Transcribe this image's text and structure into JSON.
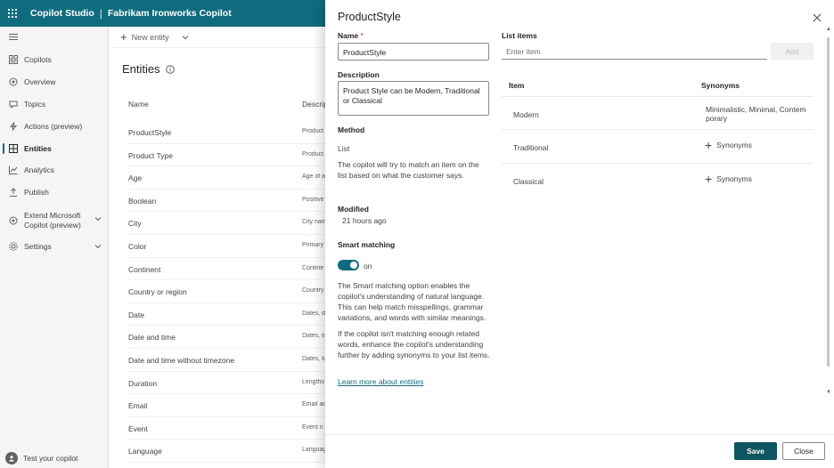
{
  "topbar": {
    "app_title": "Copilot Studio",
    "separator": "|",
    "bot_title": "Fabrikam Ironworks Copilot"
  },
  "sidebar": {
    "items": [
      {
        "label": "Copilots",
        "icon": "copilots-icon"
      },
      {
        "label": "Overview",
        "icon": "overview-icon"
      },
      {
        "label": "Topics",
        "icon": "topics-icon"
      },
      {
        "label": "Actions (preview)",
        "icon": "actions-icon"
      },
      {
        "label": "Entities",
        "icon": "entities-icon",
        "active": true
      },
      {
        "label": "Analytics",
        "icon": "analytics-icon"
      },
      {
        "label": "Publish",
        "icon": "publish-icon"
      },
      {
        "label_line1": "Extend Microsoft",
        "label_line2": "Copilot (preview)",
        "icon": "extend-icon"
      },
      {
        "label": "Settings",
        "icon": "settings-icon"
      }
    ],
    "test_bot": "Test your copilot"
  },
  "main": {
    "new_entity": "New entity",
    "page_title": "Entities",
    "col_name": "Name",
    "col_desc": "Descrip",
    "rows": [
      {
        "name": "ProductStyle",
        "desc": "Product"
      },
      {
        "name": "Product Type",
        "desc": "Product"
      },
      {
        "name": "Age",
        "desc": "Age of a"
      },
      {
        "name": "Boolean",
        "desc": "Positive"
      },
      {
        "name": "City",
        "desc": "City nam"
      },
      {
        "name": "Color",
        "desc": "Primary"
      },
      {
        "name": "Continent",
        "desc": "Contine"
      },
      {
        "name": "Country or region",
        "desc": "Country"
      },
      {
        "name": "Date",
        "desc": "Dates, d"
      },
      {
        "name": "Date and time",
        "desc": "Dates, ti"
      },
      {
        "name": "Date and time without timezone",
        "desc": "Dates, ti"
      },
      {
        "name": "Duration",
        "desc": "Lengths"
      },
      {
        "name": "Email",
        "desc": "Email ad"
      },
      {
        "name": "Event",
        "desc": "Event n"
      },
      {
        "name": "Language",
        "desc": "Languag"
      }
    ]
  },
  "panel": {
    "title": "ProductStyle",
    "name_label": "Name",
    "required_mark": "*",
    "name_value": "ProductStyle",
    "description_label": "Description",
    "description_value": "Product Style can be Modern, Traditional or Classical",
    "method_label": "Method",
    "method_value": "List",
    "method_help": "The copilot will try to match an item on the list based on what the customer says.",
    "modified_label": "Modified",
    "modified_value": "21 hours ago",
    "smart_label": "Smart matching",
    "smart_state": "on",
    "smart_enabled": true,
    "smart_help1": "The Smart matching option enables the copilot's understanding of natural language. This can help match misspellings, grammar variations, and words with similar meanings.",
    "smart_help2": "If the copilot isn't matching enough related words, enhance the copilot's understanding further by adding synonyms to your list items.",
    "learn_more": "Learn more about entities",
    "list_items_label": "List items",
    "list_input_placeholder": "Enter item",
    "add_button": "Add",
    "col_item": "Item",
    "col_synonyms": "Synonyms",
    "list": [
      {
        "item": "Modern",
        "synonyms": "Minimalistic,  Minimal,  Contemporary"
      },
      {
        "item": "Traditional",
        "synonyms": "",
        "add_label": "Synonyms"
      },
      {
        "item": "Classical",
        "synonyms": "",
        "add_label": "Synonyms"
      }
    ],
    "save_button": "Save",
    "close_button": "Close"
  },
  "colors": {
    "brand": "#0f6c7e",
    "save_bg": "#0f5561",
    "required": "#c50f1f"
  }
}
